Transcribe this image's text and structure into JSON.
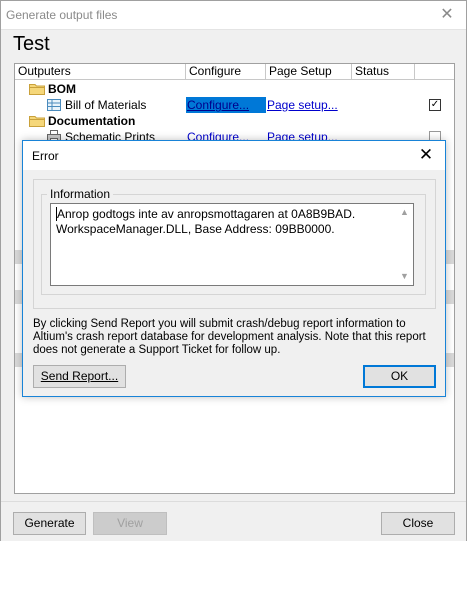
{
  "window": {
    "title": "Generate output files",
    "close_glyph": "✕",
    "heading": "Test"
  },
  "grid": {
    "columns": [
      "Outputers",
      "Configure",
      "Page Setup",
      "Status"
    ],
    "rows": [
      {
        "type": "group",
        "label": "BOM",
        "icon": "folder-icon"
      },
      {
        "type": "item",
        "label": "Bill of Materials",
        "icon": "bom-table-icon",
        "configure": "Configure...",
        "page_setup": "Page setup...",
        "checked": true
      },
      {
        "type": "group",
        "label": "Documentation",
        "icon": "folder-icon"
      },
      {
        "type": "item",
        "label": "Schematic Prints",
        "icon": "printer-icon",
        "configure": "Configure...",
        "page_setup": "Page setup...",
        "checked": false
      }
    ],
    "check_glyph": "✓"
  },
  "buttons": {
    "generate": "Generate",
    "view": "View",
    "close": "Close"
  },
  "error_dialog": {
    "title": "Error",
    "close_glyph": "✕",
    "group_label": "Information",
    "message_line1": "Anrop godtogs inte av anropsmottagaren at 0A8B9BAD.",
    "message_line2": "WorkspaceManager.DLL, Base Address: 09BB0000.",
    "scroll_up": "▲",
    "scroll_down": "▼",
    "note": "By clicking Send Report you will submit crash/debug report information to Altium's crash report database for development analysis. Note that this report does not generate a Support Ticket for follow up.",
    "send_report": "Send Report...",
    "ok": "OK"
  },
  "colors": {
    "link": "#0000cc",
    "selection": "#0078d7",
    "dialog_border": "#1883d7",
    "folder": "#e8c25a"
  }
}
